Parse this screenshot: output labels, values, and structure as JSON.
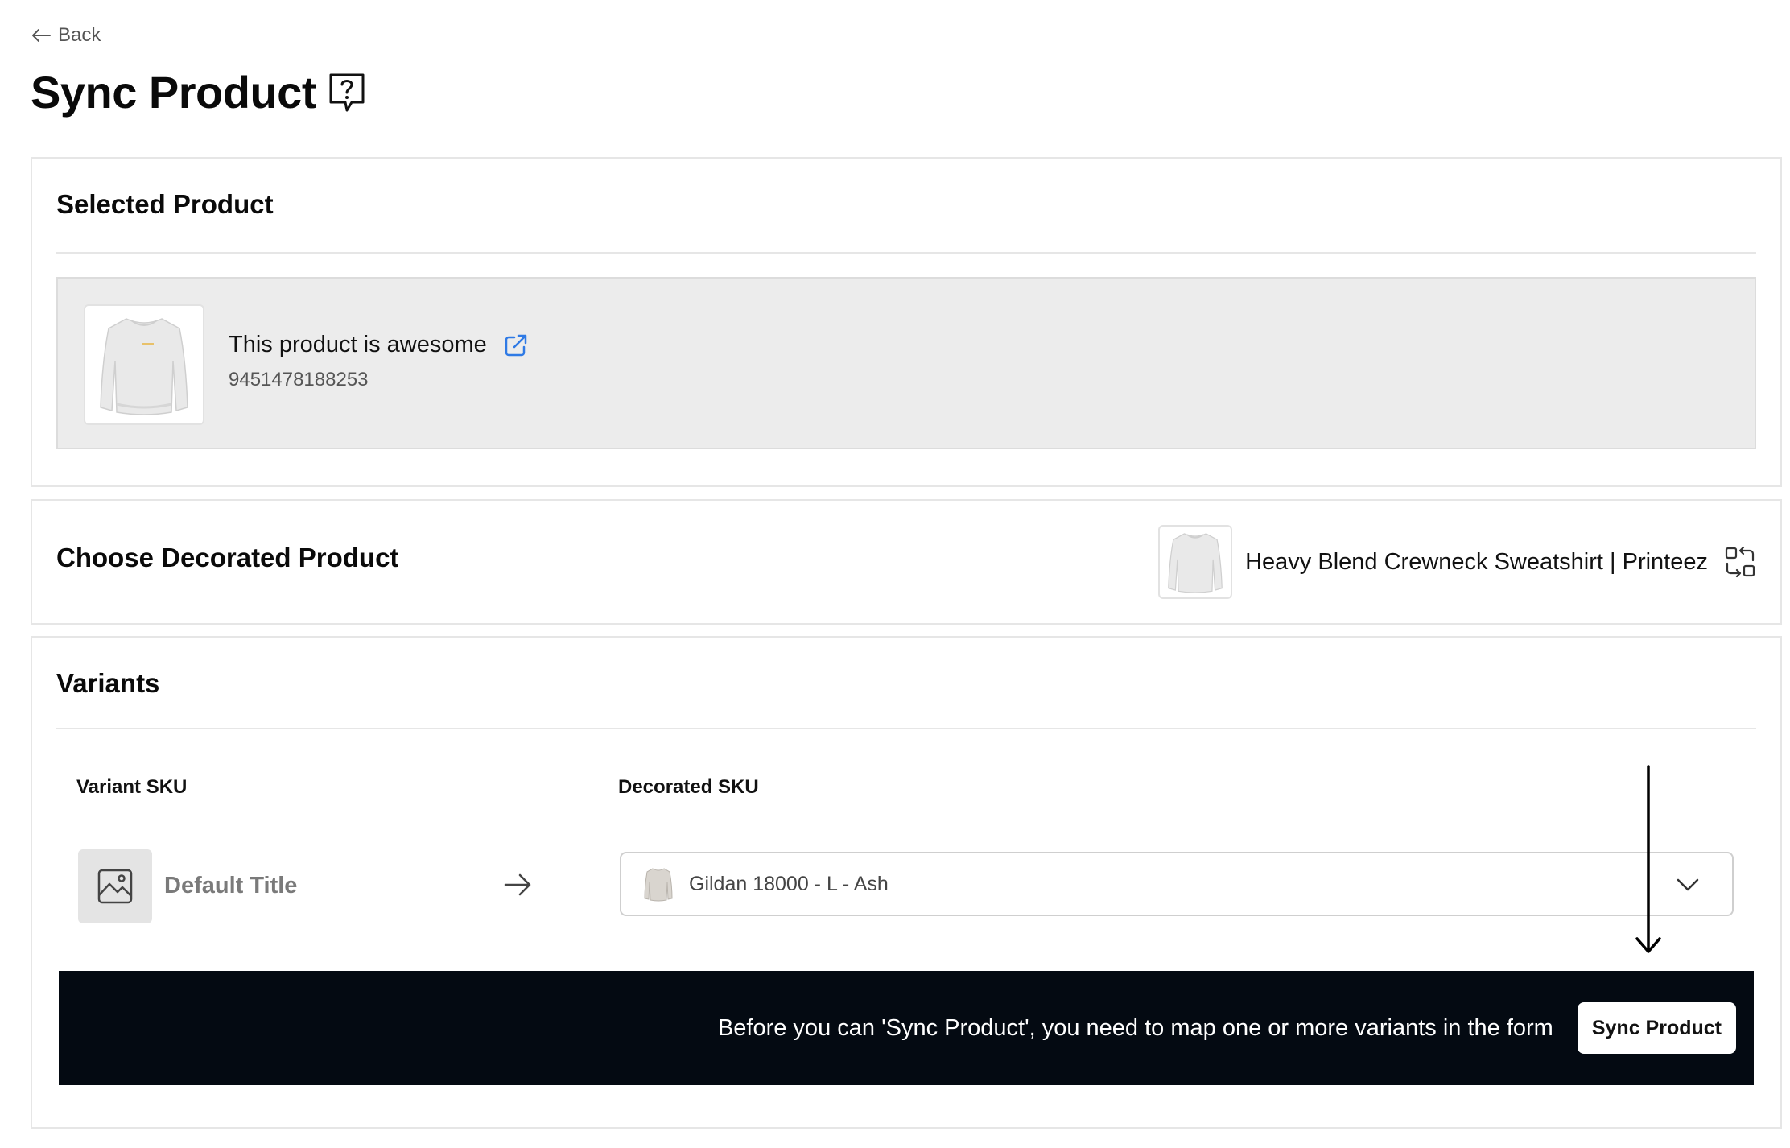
{
  "header": {
    "back_label": "Back",
    "title": "Sync Product"
  },
  "selected_product": {
    "section_title": "Selected Product",
    "name": "This product is awesome",
    "id": "9451478188253"
  },
  "decorated_product": {
    "section_title": "Choose Decorated Product",
    "selected_name": "Heavy Blend Crewneck Sweatshirt | Printeez"
  },
  "variants": {
    "section_title": "Variants",
    "col_variant_sku": "Variant SKU",
    "col_decorated_sku": "Decorated SKU",
    "rows": [
      {
        "variant_title": "Default Title",
        "decorated_sku": "Gildan 18000 - L - Ash"
      }
    ]
  },
  "sync_banner": {
    "message": "Before you can 'Sync Product', you need to map one or more variants in the form",
    "button_label": "Sync Product"
  },
  "colors": {
    "banner_bg": "#040a12",
    "link_icon": "#2f7ae5",
    "panel_bg": "#ececec"
  }
}
